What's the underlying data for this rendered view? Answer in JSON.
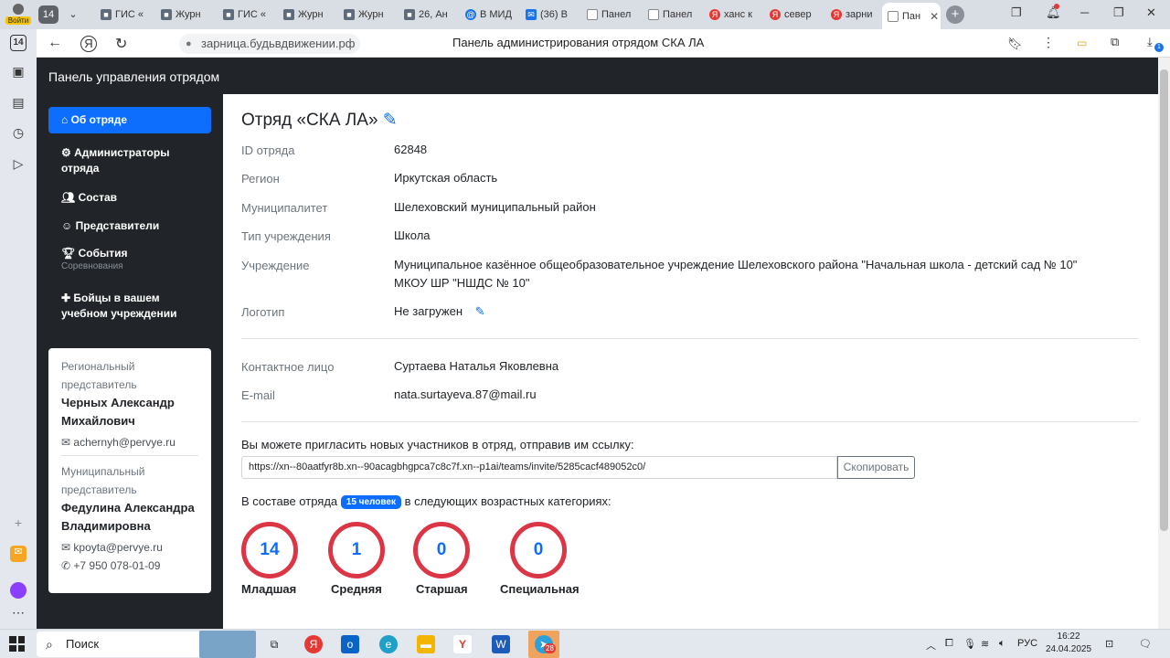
{
  "browser": {
    "tab_count": "14",
    "tabs": [
      {
        "label": "ГИС «",
        "color": "#5f6b7a"
      },
      {
        "label": "Журн",
        "color": "#5f6b7a"
      },
      {
        "label": "ГИС «",
        "color": "#5f6b7a"
      },
      {
        "label": "Журн",
        "color": "#5f6b7a"
      },
      {
        "label": "Журн",
        "color": "#5f6b7a"
      },
      {
        "label": "26, Ан",
        "color": "#5f6b7a"
      },
      {
        "label": "В МИД",
        "color": "#1a73e8"
      },
      {
        "label": "(36) В",
        "color": "#1a73e8"
      },
      {
        "label": "Панел",
        "color": "#888888"
      },
      {
        "label": "Панел",
        "color": "#888888"
      },
      {
        "label": "ханс к",
        "color": "#e53935"
      },
      {
        "label": "север",
        "color": "#e53935"
      },
      {
        "label": "зарни",
        "color": "#e53935"
      },
      {
        "label": "Пан",
        "color": "#888888"
      }
    ],
    "address": "зарница.будьвдвижении.рф",
    "page_title": "Панель администрирования отрядом СКА ЛА",
    "login_label": "Войти",
    "downloads_badge": "1"
  },
  "app": {
    "brand": "Панель управления отрядом",
    "nav": [
      {
        "label": "Об отряде",
        "icon": "home-icon"
      },
      {
        "label": "Администраторы отряда",
        "icon": "user-cog-icon"
      },
      {
        "label": "Состав",
        "icon": "users-icon"
      },
      {
        "label": "Представители",
        "icon": "people-icon"
      },
      {
        "label": "События",
        "icon": "trophy-icon"
      },
      {
        "label": "Бойцы в вашем учебном учреждении",
        "icon": "user-plus-icon"
      }
    ],
    "nav_sub": "Соревнования",
    "reps": {
      "regional_label": "Региональный представитель",
      "regional_name": "Черных Александр Михайлович",
      "regional_email": "achernyh@pervye.ru",
      "municipal_label": "Муниципальный представитель",
      "municipal_name": "Федулина Александра Владимировна",
      "municipal_email": "kpoyta@pervye.ru",
      "municipal_phone": "+7 950 078-01-09"
    }
  },
  "squad": {
    "title": "Отряд «СКА ЛА»",
    "fields": [
      {
        "label": "ID отряда",
        "value": "62848"
      },
      {
        "label": "Регион",
        "value": "Иркутская область"
      },
      {
        "label": "Муниципалитет",
        "value": "Шелеховский муниципальный район"
      },
      {
        "label": "Тип учреждения",
        "value": "Школа"
      },
      {
        "label": "Учреждение",
        "value": "Муниципальное казённое общеобразовательное учреждение Шелеховского района \"Начальная школа - детский сад № 10\"",
        "value2": "МКОУ ШР \"НШДС № 10\""
      },
      {
        "label": "Логотип",
        "value": "Не загружен"
      }
    ],
    "contact": [
      {
        "label": "Контактное лицо",
        "value": "Суртаева Наталья Яковлевна"
      },
      {
        "label": "E-mail",
        "value": "nata.surtayeva.87@mail.ru"
      }
    ],
    "invite_text": "Вы можете пригласить новых участников в отряд, отправив им ссылку:",
    "invite_link": "https://xn--80aatfyr8b.xn--90acagbhgpca7c8c7f.xn--p1ai/teams/invite/5285cacf489052c0/",
    "copy_label": "Скопировать",
    "members_prefix": "В составе отряда",
    "members_badge": "15 человек",
    "members_suffix": "в следующих возрастных категориях:",
    "categories": [
      {
        "label": "Младшая",
        "count": "14"
      },
      {
        "label": "Средняя",
        "count": "1"
      },
      {
        "label": "Старшая",
        "count": "0"
      },
      {
        "label": "Специальная",
        "count": "0"
      }
    ]
  },
  "taskbar": {
    "search_label": "Поиск",
    "lang": "РУС",
    "time": "16:22",
    "date": "24.04.2025",
    "telegram_badge": "28"
  }
}
